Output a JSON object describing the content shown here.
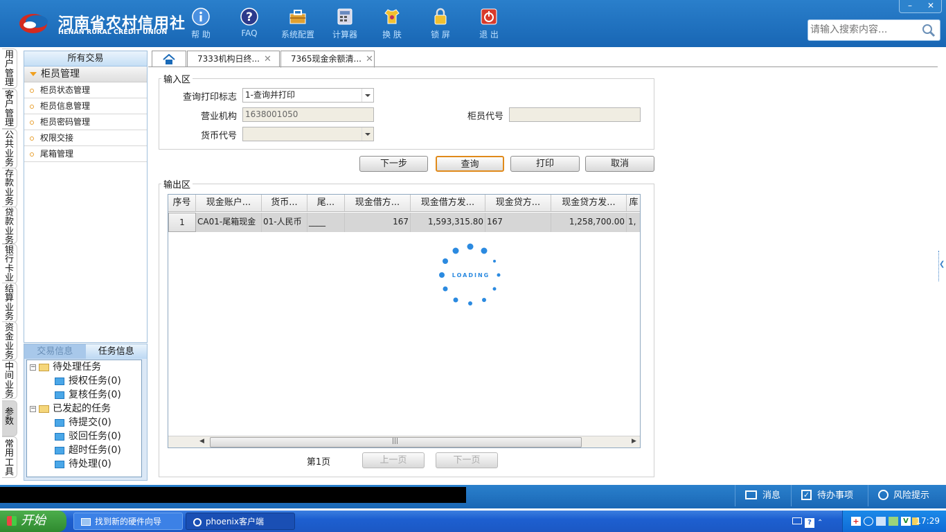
{
  "app": {
    "logo_cn": "河南省农村信用社",
    "logo_en": "HENAN RURAL CREDIT UNION",
    "toolbar": [
      "帮 助",
      "FAQ",
      "系统配置",
      "计算器",
      "换 肤",
      "锁 屏",
      "退 出"
    ],
    "window_buttons": [
      "–",
      "✕"
    ],
    "search_placeholder": "请输入搜索内容..."
  },
  "left_tabs": [
    "用户管理",
    "客户管理",
    "公共业务",
    "存款业务",
    "贷款业务",
    "银行卡业务",
    "结算业务",
    "资金业务",
    "中间业务",
    "参数",
    "常用工具"
  ],
  "sidebar": {
    "header": "所有交易",
    "group": "柜员管理",
    "items": [
      "柜员状态管理",
      "柜员信息管理",
      "柜员密码管理",
      "权限交接",
      "尾箱管理"
    ]
  },
  "task_panel": {
    "tabs": [
      "交易信息",
      "任务信息"
    ],
    "tree": {
      "pending": "待处理任务",
      "pending_items": [
        "授权任务(0)",
        "复核任务(0)"
      ],
      "launched": "已发起的任务",
      "launched_items": [
        "待提交(0)",
        "驳回任务(0)",
        "超时任务(0)",
        "待处理(0)"
      ]
    }
  },
  "tabs": [
    "7333机构日终...",
    "7365现金余额清..."
  ],
  "input_area": {
    "legend": "输入区",
    "query_flag_label": "查询打印标志",
    "query_flag_value": "1-查询并打印",
    "branch_label": "营业机构",
    "branch_value": "1638001050",
    "teller_label": "柜员代号",
    "teller_value": "",
    "currency_label": "货币代号",
    "currency_value": ""
  },
  "buttons": [
    "下一步",
    "查询",
    "打印",
    "取消"
  ],
  "output_area": {
    "legend": "输出区",
    "columns": [
      "序号",
      "现金账户...",
      "货币...",
      "尾...",
      "现金借方...",
      "现金借方发...",
      "现金贷方...",
      "现金贷方发...",
      "库"
    ],
    "rows": [
      [
        "1",
        "CA01-尾箱现金",
        "01-人民币",
        "____",
        "167",
        "1,593,315.80",
        "167",
        "1,258,700.00",
        "1,"
      ]
    ],
    "loading_text": "LOADING",
    "scroll_grip": "|||"
  },
  "pagination": {
    "page_label": "第1页",
    "prev": "上一页",
    "next": "下一页"
  },
  "statusbar": {
    "message": "消息",
    "todo": "待办事项",
    "risk": "风险提示"
  },
  "taskbar": {
    "start": "开始",
    "windows": [
      "找到新的硬件向导",
      "phoenix客户端"
    ],
    "clock": "17:29"
  },
  "colors": {
    "brand_blue": "#1f72c2",
    "focus_orange": "#e08a1a"
  }
}
